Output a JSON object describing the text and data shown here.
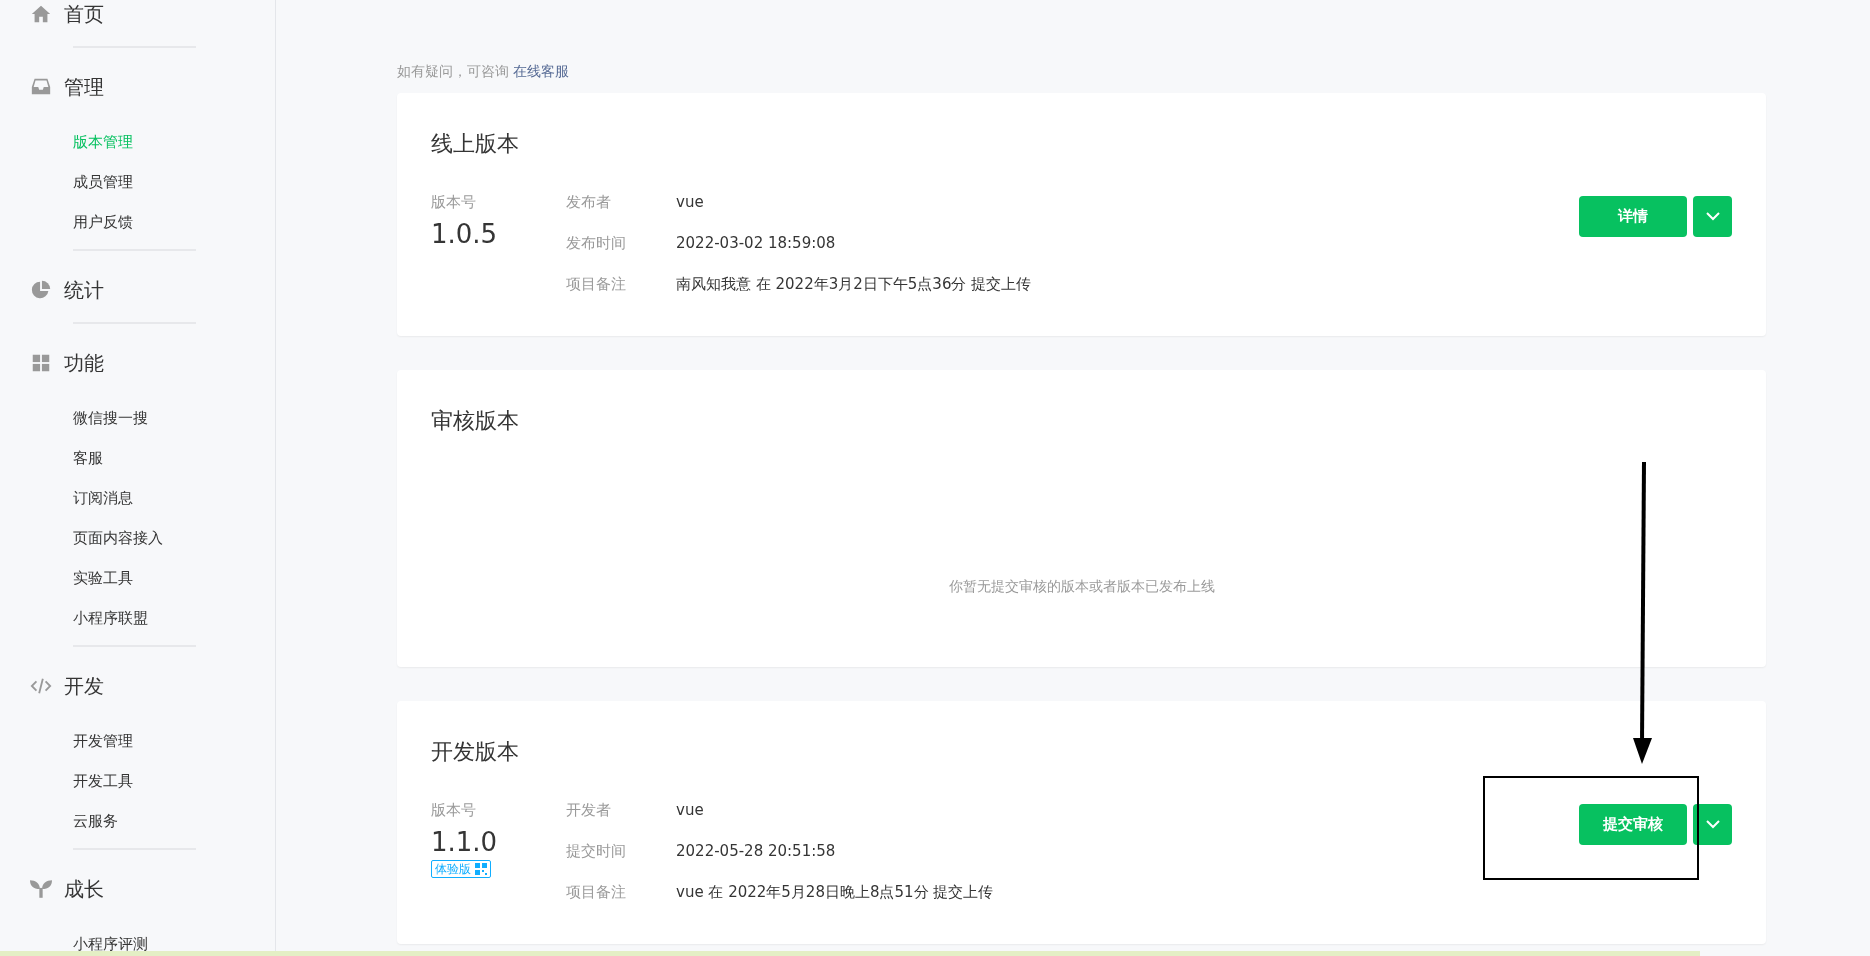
{
  "sidebar": {
    "groups": [
      {
        "label": "首页"
      },
      {
        "label": "管理",
        "items": [
          {
            "label": "版本管理",
            "selected": true
          },
          {
            "label": "成员管理",
            "selected": false
          },
          {
            "label": "用户反馈",
            "selected": false
          }
        ]
      },
      {
        "label": "统计"
      },
      {
        "label": "功能",
        "items": [
          {
            "label": "微信搜一搜",
            "selected": false
          },
          {
            "label": "客服",
            "selected": false
          },
          {
            "label": "订阅消息",
            "selected": false
          },
          {
            "label": "页面内容接入",
            "selected": false
          },
          {
            "label": "实验工具",
            "selected": false
          },
          {
            "label": "小程序联盟",
            "selected": false
          }
        ]
      },
      {
        "label": "开发",
        "items": [
          {
            "label": "开发管理",
            "selected": false
          },
          {
            "label": "开发工具",
            "selected": false
          },
          {
            "label": "云服务",
            "selected": false
          }
        ]
      },
      {
        "label": "成长",
        "items": [
          {
            "label": "小程序评测",
            "selected": false
          }
        ]
      }
    ]
  },
  "page": {
    "hint": "如有疑问，可咨询",
    "hint_link": "在线客服"
  },
  "cards": [
    {
      "kind": "details",
      "title": "线上版本",
      "version_label": "版本号",
      "version": "1.0.5",
      "fields": [
        {
          "label": "发布者",
          "value": "vue"
        },
        {
          "label": "发布时间",
          "value": "2022-03-02 18:59:08"
        },
        {
          "label": "项目备注",
          "value": "南风知我意 在 2022年3月2日下午5点36分 提交上传"
        }
      ],
      "button": "详情"
    },
    {
      "kind": "empty",
      "title": "审核版本",
      "message": "你暂无提交审核的版本或者版本已发布上线"
    },
    {
      "kind": "details",
      "title": "开发版本",
      "version_label": "版本号",
      "version": "1.1.0",
      "badge": "体验版",
      "fields": [
        {
          "label": "开发者",
          "value": "vue"
        },
        {
          "label": "提交时间",
          "value": "2022-05-28 20:51:58"
        },
        {
          "label": "项目备注",
          "value": "vue 在 2022年5月28日晚上8点51分 提交上传"
        }
      ],
      "button": "提交审核",
      "highlighted": true
    }
  ]
}
